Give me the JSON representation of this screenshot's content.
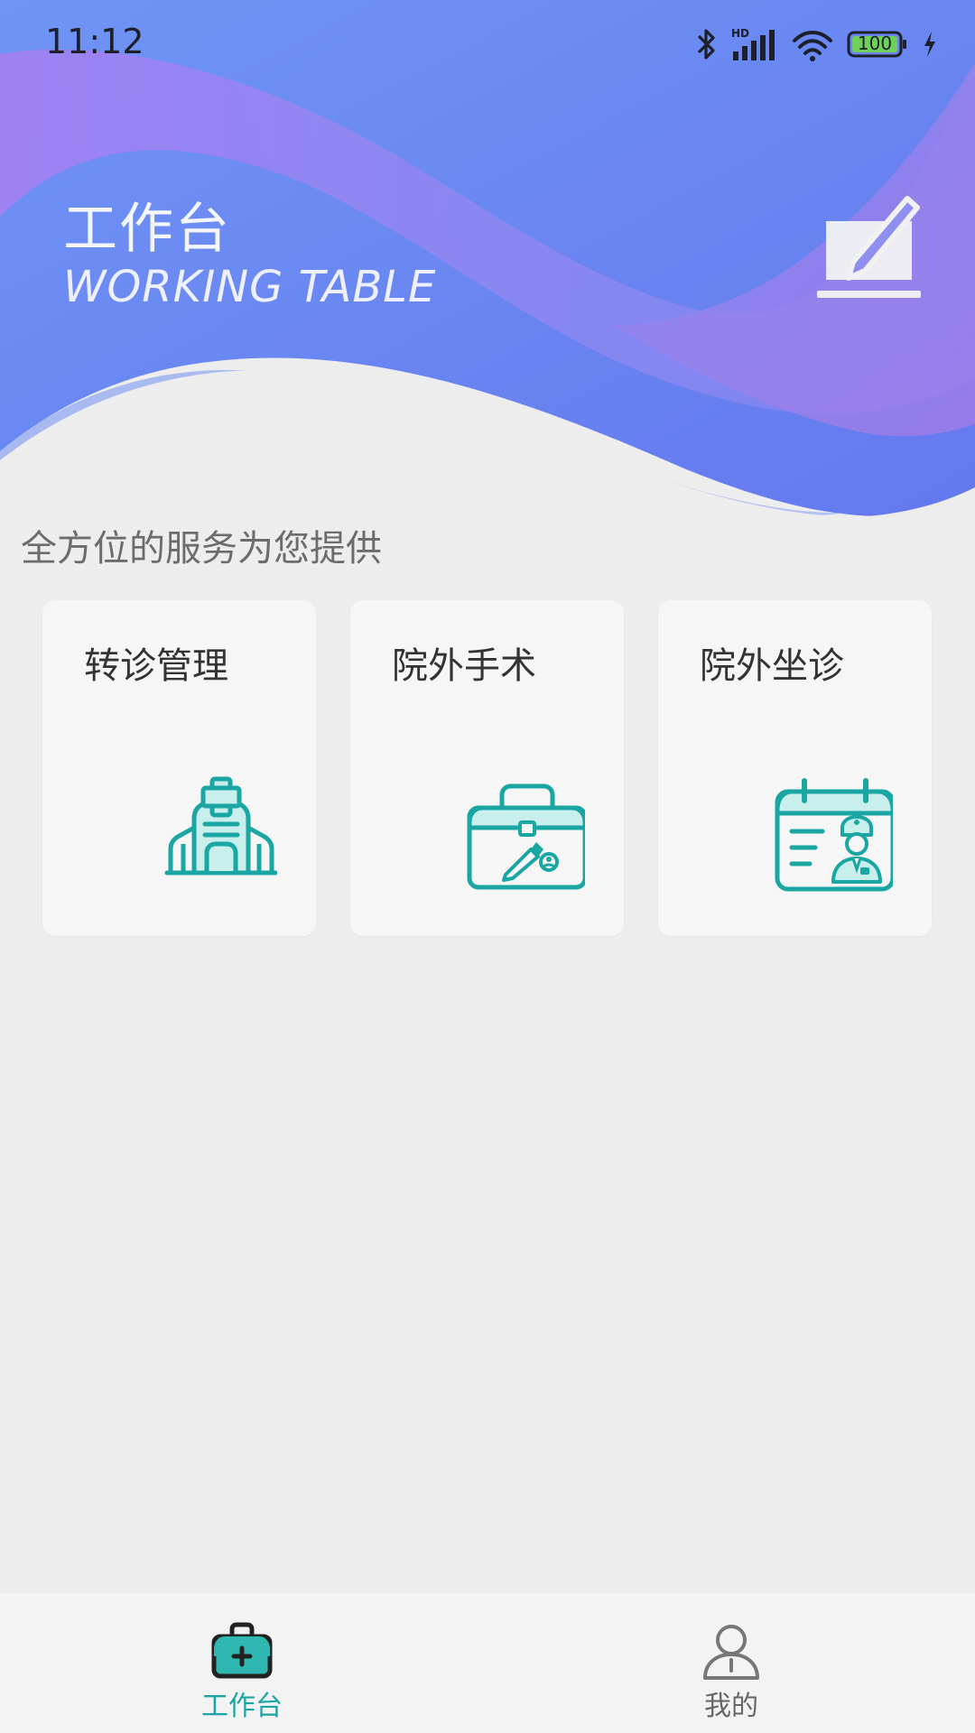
{
  "status_bar": {
    "time": "11:12",
    "battery": "100",
    "icons": [
      "bluetooth-icon",
      "signal-hd-icon",
      "wifi-icon",
      "battery-icon",
      "charging-icon"
    ]
  },
  "header": {
    "title": "工作台",
    "subtitle": "WORKING TABLE",
    "action_icon": "edit-icon"
  },
  "section": {
    "title": "全方位的服务为您提供"
  },
  "cards": [
    {
      "label": "转诊管理",
      "icon": "hospital-icon"
    },
    {
      "label": "院外手术",
      "icon": "medical-kit-icon"
    },
    {
      "label": "院外坐诊",
      "icon": "doctor-calendar-icon"
    }
  ],
  "bottom_nav": {
    "items": [
      {
        "label": "工作台",
        "icon": "medical-box-icon",
        "active": true
      },
      {
        "label": "我的",
        "icon": "user-icon",
        "active": false
      }
    ]
  },
  "colors": {
    "header_blue": "#6a86f0",
    "header_purple": "#9b7ff0",
    "accent_teal": "#1aa6a2",
    "background": "#ededed",
    "card_background": "#f6f6f6"
  }
}
